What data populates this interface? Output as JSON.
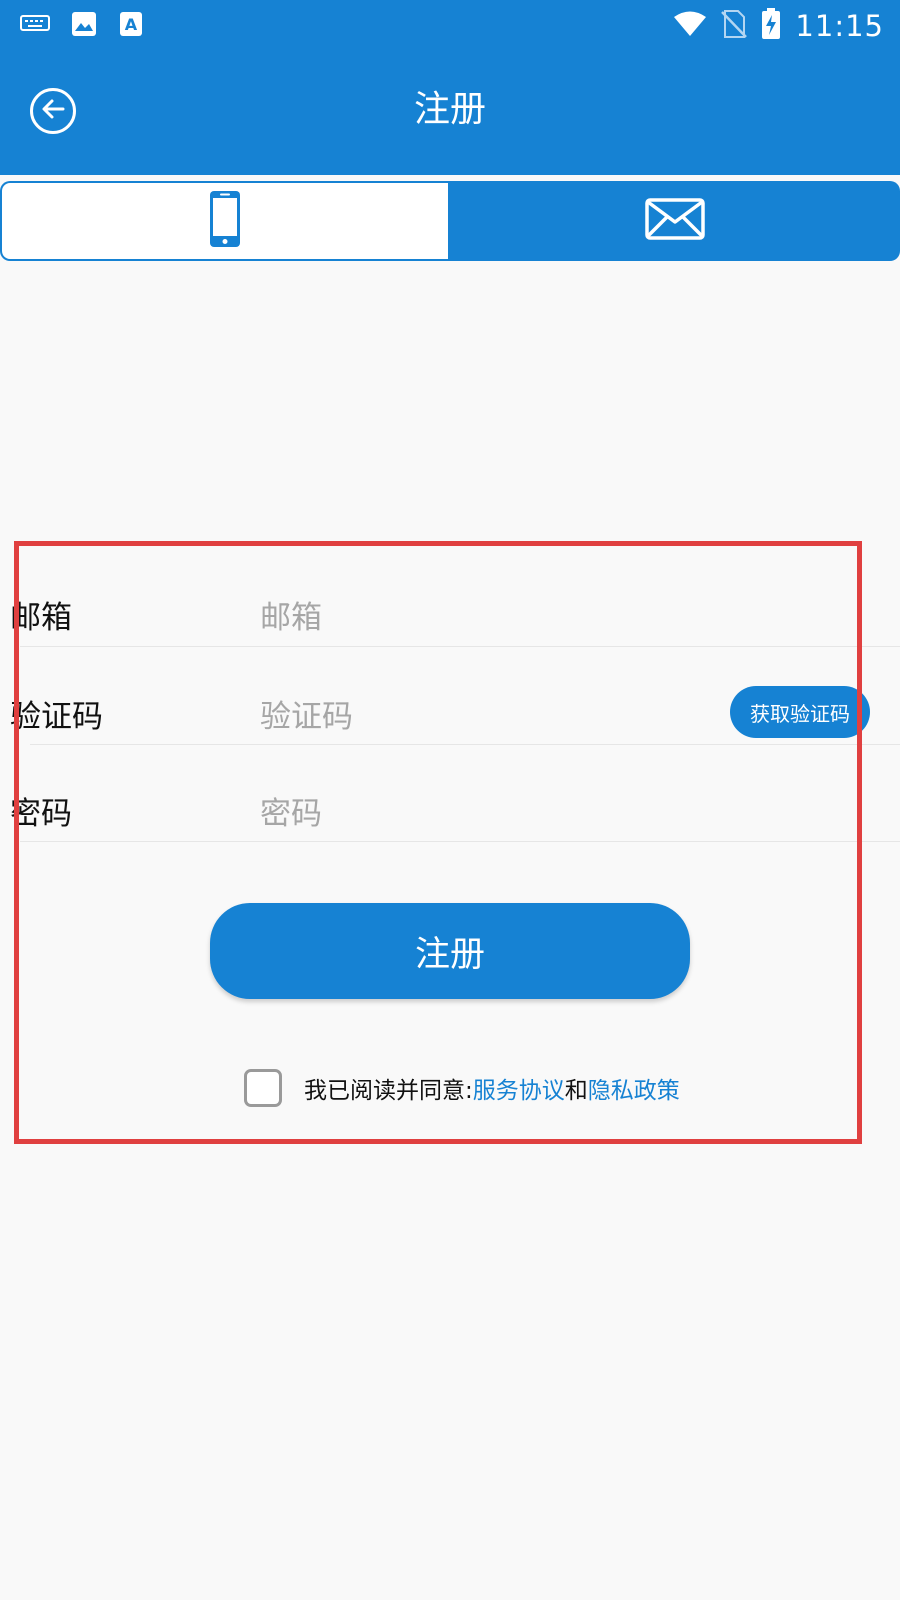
{
  "status_bar": {
    "time": "11:15",
    "icons": [
      "keyboard-icon",
      "image-icon",
      "text-a-icon",
      "wifi-icon",
      "no-sim-icon",
      "battery-charging-icon"
    ]
  },
  "toolbar": {
    "title": "注册",
    "back_icon": "back-arrow-icon"
  },
  "tabs": [
    {
      "icon": "phone-icon",
      "selected": false
    },
    {
      "icon": "mail-icon",
      "selected": true
    }
  ],
  "form": {
    "email": {
      "label": "邮箱",
      "placeholder": "邮箱",
      "value": ""
    },
    "code": {
      "label": "验证码",
      "placeholder": "验证码",
      "value": "",
      "button": "获取验证码"
    },
    "password": {
      "label": "密码",
      "placeholder": "密码",
      "value": ""
    }
  },
  "submit_label": "注册",
  "agreement": {
    "checked": false,
    "prefix": "我已阅读并同意:",
    "service_link": "服务协议",
    "and": "和",
    "privacy_link": "隐私政策"
  },
  "colors": {
    "primary": "#1682d3",
    "background": "#f9f9f9",
    "highlight": "#e04040"
  }
}
